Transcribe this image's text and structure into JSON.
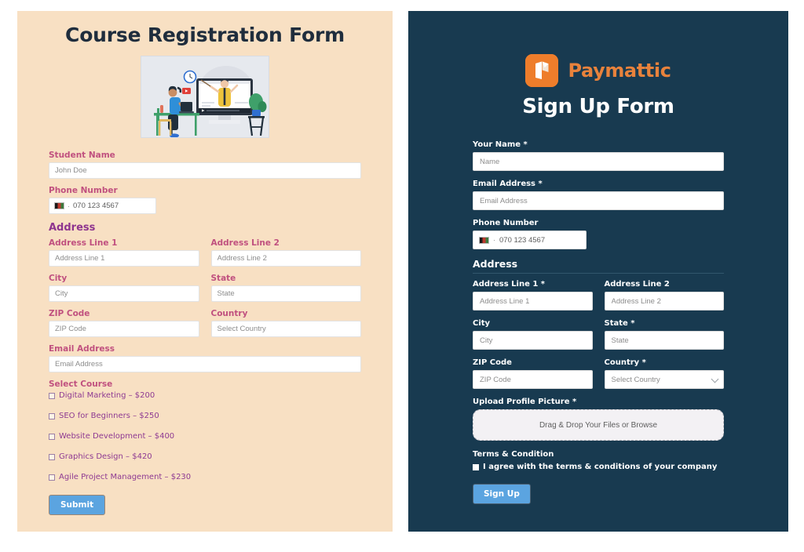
{
  "left_form": {
    "title": "Course Registration Form",
    "hero_alt": "elearning-illustration",
    "student_name": {
      "label": "Student Name",
      "placeholder": "John Doe"
    },
    "phone": {
      "label": "Phone Number",
      "value": "070 123 4567",
      "flag": "afghanistan-flag-icon",
      "separator": "·"
    },
    "address_heading": "Address",
    "address_line1": {
      "label": "Address Line 1",
      "placeholder": "Address Line 1"
    },
    "address_line2": {
      "label": "Address Line 2",
      "placeholder": "Address Line 2"
    },
    "city": {
      "label": "City",
      "placeholder": "City"
    },
    "state": {
      "label": "State",
      "placeholder": "State"
    },
    "zip": {
      "label": "ZIP Code",
      "placeholder": "ZIP Code"
    },
    "country": {
      "label": "Country",
      "placeholder": "Select Country"
    },
    "email": {
      "label": "Email Address",
      "placeholder": "Email Address"
    },
    "select_course_label": "Select Course",
    "courses": [
      {
        "name": "Digital Marketing",
        "dash": "–",
        "price": "$200"
      },
      {
        "name": "SEO for Beginners",
        "dash": "–",
        "price": "$250"
      },
      {
        "name": "Website Development",
        "dash": "–",
        "price": "$400"
      },
      {
        "name": "Graphics Design",
        "dash": "–",
        "price": "$420"
      },
      {
        "name": "Agile Project Management",
        "dash": "–",
        "price": "$230"
      }
    ],
    "submit_label": "Submit",
    "colors": {
      "background": "#f8e0c3",
      "title": "#1f2d3d",
      "label": "#c0507f",
      "section_heading": "#8e358f",
      "course_text": "#8e3a92",
      "button": "#5ba4e0"
    }
  },
  "right_form": {
    "brand": "Paymattic",
    "brand_icon": "paymattic-logo-icon",
    "title": "Sign Up Form",
    "your_name": {
      "label": "Your Name *",
      "placeholder": "Name"
    },
    "email": {
      "label": "Email Address *",
      "placeholder": "Email Address"
    },
    "phone": {
      "label": "Phone Number",
      "value": "070 123 4567",
      "flag": "afghanistan-flag-icon",
      "separator": "·"
    },
    "address_heading": "Address",
    "address_line1": {
      "label": "Address Line 1 *",
      "placeholder": "Address Line 1"
    },
    "address_line2": {
      "label": "Address Line 2",
      "placeholder": "Address Line 2"
    },
    "city": {
      "label": "City",
      "placeholder": "City"
    },
    "state": {
      "label": "State *",
      "placeholder": "State"
    },
    "zip": {
      "label": "ZIP Code",
      "placeholder": "ZIP Code"
    },
    "country": {
      "label": "Country *",
      "selected": "Select Country"
    },
    "upload": {
      "label": "Upload Profile Picture *",
      "dropzone_text": "Drag & Drop Your Files or Browse"
    },
    "terms": {
      "heading": "Terms & Condition",
      "text": "I agree with the terms & conditions of your company"
    },
    "submit_label": "Sign Up",
    "colors": {
      "background": "#183a50",
      "brand": "#e8823c",
      "logo_mark": "#ee7d2b",
      "title": "#ffffff",
      "label": "#ffffff",
      "button": "#5ba4e0"
    }
  }
}
